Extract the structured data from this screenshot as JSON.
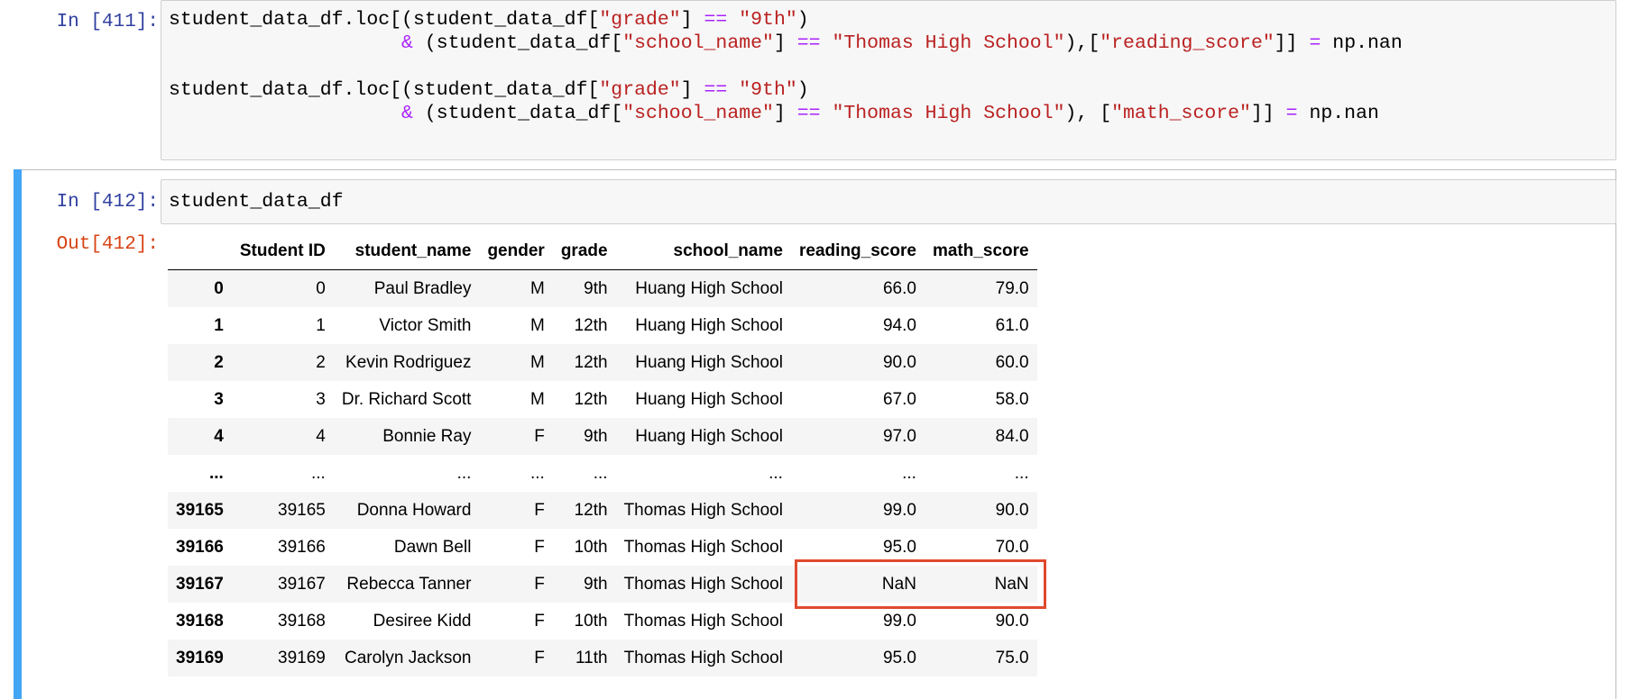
{
  "cells": {
    "cell_411": {
      "prompt": "In [411]:",
      "code_lines": [
        [
          {
            "t": "pl",
            "s": "student_data_df.loc[(student_data_df["
          },
          {
            "t": "str",
            "s": "\"grade\""
          },
          {
            "t": "pl",
            "s": "] "
          },
          {
            "t": "op",
            "s": "=="
          },
          {
            "t": "pl",
            "s": " "
          },
          {
            "t": "str",
            "s": "\"9th\""
          },
          {
            "t": "pl",
            "s": ")"
          }
        ],
        [
          {
            "t": "pl",
            "s": "                    "
          },
          {
            "t": "op",
            "s": "&"
          },
          {
            "t": "pl",
            "s": " (student_data_df["
          },
          {
            "t": "str",
            "s": "\"school_name\""
          },
          {
            "t": "pl",
            "s": "] "
          },
          {
            "t": "op",
            "s": "=="
          },
          {
            "t": "pl",
            "s": " "
          },
          {
            "t": "str",
            "s": "\"Thomas High School\""
          },
          {
            "t": "pl",
            "s": "),["
          },
          {
            "t": "str",
            "s": "\"reading_score\""
          },
          {
            "t": "pl",
            "s": "]] "
          },
          {
            "t": "op",
            "s": "="
          },
          {
            "t": "pl",
            "s": " np.nan"
          }
        ],
        [],
        [
          {
            "t": "pl",
            "s": "student_data_df.loc[(student_data_df["
          },
          {
            "t": "str",
            "s": "\"grade\""
          },
          {
            "t": "pl",
            "s": "] "
          },
          {
            "t": "op",
            "s": "=="
          },
          {
            "t": "pl",
            "s": " "
          },
          {
            "t": "str",
            "s": "\"9th\""
          },
          {
            "t": "pl",
            "s": ")"
          }
        ],
        [
          {
            "t": "pl",
            "s": "                    "
          },
          {
            "t": "op",
            "s": "&"
          },
          {
            "t": "pl",
            "s": " (student_data_df["
          },
          {
            "t": "str",
            "s": "\"school_name\""
          },
          {
            "t": "pl",
            "s": "] "
          },
          {
            "t": "op",
            "s": "=="
          },
          {
            "t": "pl",
            "s": " "
          },
          {
            "t": "str",
            "s": "\"Thomas High School\""
          },
          {
            "t": "pl",
            "s": "), ["
          },
          {
            "t": "str",
            "s": "\"math_score\""
          },
          {
            "t": "pl",
            "s": "]] "
          },
          {
            "t": "op",
            "s": "="
          },
          {
            "t": "pl",
            "s": " np.nan"
          }
        ]
      ]
    },
    "cell_412": {
      "prompt_in": "In [412]:",
      "code": "student_data_df",
      "prompt_out": "Out[412]:",
      "table": {
        "columns": [
          "",
          "Student ID",
          "student_name",
          "gender",
          "grade",
          "school_name",
          "reading_score",
          "math_score"
        ],
        "rows": [
          {
            "index": "0",
            "cells": [
              "0",
              "Paul Bradley",
              "M",
              "9th",
              "Huang High School",
              "66.0",
              "79.0"
            ]
          },
          {
            "index": "1",
            "cells": [
              "1",
              "Victor Smith",
              "M",
              "12th",
              "Huang High School",
              "94.0",
              "61.0"
            ]
          },
          {
            "index": "2",
            "cells": [
              "2",
              "Kevin Rodriguez",
              "M",
              "12th",
              "Huang High School",
              "90.0",
              "60.0"
            ]
          },
          {
            "index": "3",
            "cells": [
              "3",
              "Dr. Richard Scott",
              "M",
              "12th",
              "Huang High School",
              "67.0",
              "58.0"
            ]
          },
          {
            "index": "4",
            "cells": [
              "4",
              "Bonnie Ray",
              "F",
              "9th",
              "Huang High School",
              "97.0",
              "84.0"
            ]
          },
          {
            "index": "...",
            "cells": [
              "...",
              "...",
              "...",
              "...",
              "...",
              "...",
              "..."
            ]
          },
          {
            "index": "39165",
            "cells": [
              "39165",
              "Donna Howard",
              "F",
              "12th",
              "Thomas High School",
              "99.0",
              "90.0"
            ]
          },
          {
            "index": "39166",
            "cells": [
              "39166",
              "Dawn Bell",
              "F",
              "10th",
              "Thomas High School",
              "95.0",
              "70.0"
            ]
          },
          {
            "index": "39167",
            "cells": [
              "39167",
              "Rebecca Tanner",
              "F",
              "9th",
              "Thomas High School",
              "NaN",
              "NaN"
            ]
          },
          {
            "index": "39168",
            "cells": [
              "39168",
              "Desiree Kidd",
              "F",
              "10th",
              "Thomas High School",
              "99.0",
              "90.0"
            ]
          },
          {
            "index": "39169",
            "cells": [
              "39169",
              "Carolyn Jackson",
              "F",
              "11th",
              "Thomas High School",
              "95.0",
              "75.0"
            ]
          }
        ]
      }
    }
  },
  "colors": {
    "prompt_in": "#303f9f",
    "prompt_out": "#d84315",
    "string": "#ba2121",
    "operator": "#aa22ff",
    "selected_cell_bar": "#42a5f5",
    "highlight_box": "#e04a2d"
  }
}
